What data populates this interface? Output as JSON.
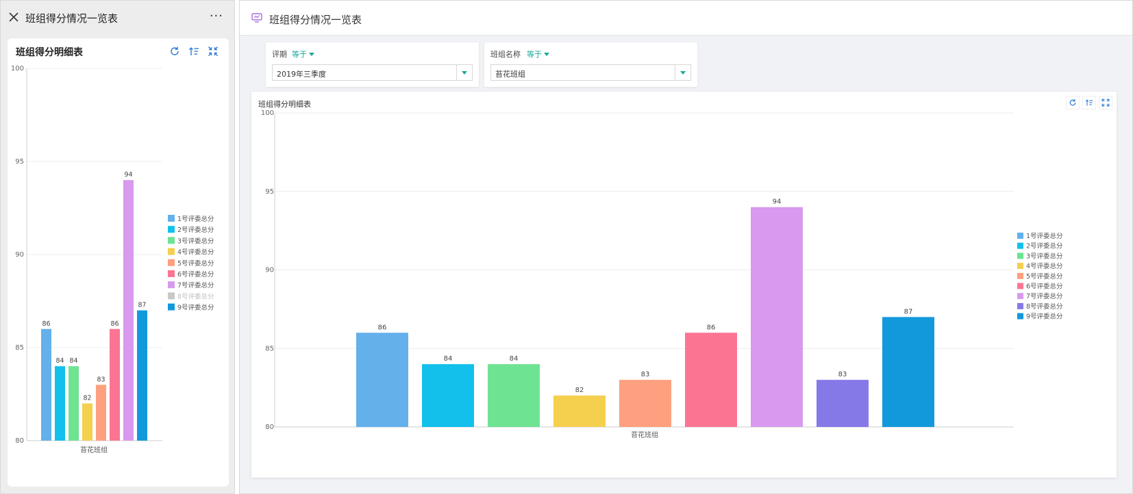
{
  "left": {
    "header_title": "班组得分情况一览表",
    "more_label": "···",
    "card_title": "班组得分明细表"
  },
  "right": {
    "header_title": "班组得分情况一览表",
    "filters": [
      {
        "label": "评期",
        "operator": "等于",
        "value": "2019年三季度"
      },
      {
        "label": "班组名称",
        "operator": "等于",
        "value": "苔花班组"
      }
    ],
    "card_title": "班组得分明细表"
  },
  "colors": {
    "accent": "#1aa899",
    "grid": "#ececec",
    "axis": "#cccccc"
  },
  "chart_data": {
    "type": "bar",
    "categories": [
      "苔花班组"
    ],
    "y_ticks": [
      80,
      85,
      90,
      95,
      100
    ],
    "ylim": [
      80,
      100
    ],
    "series": [
      {
        "name": "1号评委总分",
        "values": [
          86
        ],
        "color": "#63b0eb"
      },
      {
        "name": "2号评委总分",
        "values": [
          84
        ],
        "color": "#12c0eb"
      },
      {
        "name": "3号评委总分",
        "values": [
          84
        ],
        "color": "#6ee392"
      },
      {
        "name": "4号评委总分",
        "values": [
          82
        ],
        "color": "#f5cf4e"
      },
      {
        "name": "5号评委总分",
        "values": [
          83
        ],
        "color": "#fda07f"
      },
      {
        "name": "6号评委总分",
        "values": [
          86
        ],
        "color": "#fb7593"
      },
      {
        "name": "7号评委总分",
        "values": [
          94
        ],
        "color": "#d899ee"
      },
      {
        "name": "8号评委总分",
        "values": [
          83
        ],
        "color": "#8579e8"
      },
      {
        "name": "9号评委总分",
        "values": [
          87
        ],
        "color": "#1299dc"
      }
    ],
    "left_hidden_series": [
      "8号评委总分"
    ],
    "legend_position": "right"
  }
}
